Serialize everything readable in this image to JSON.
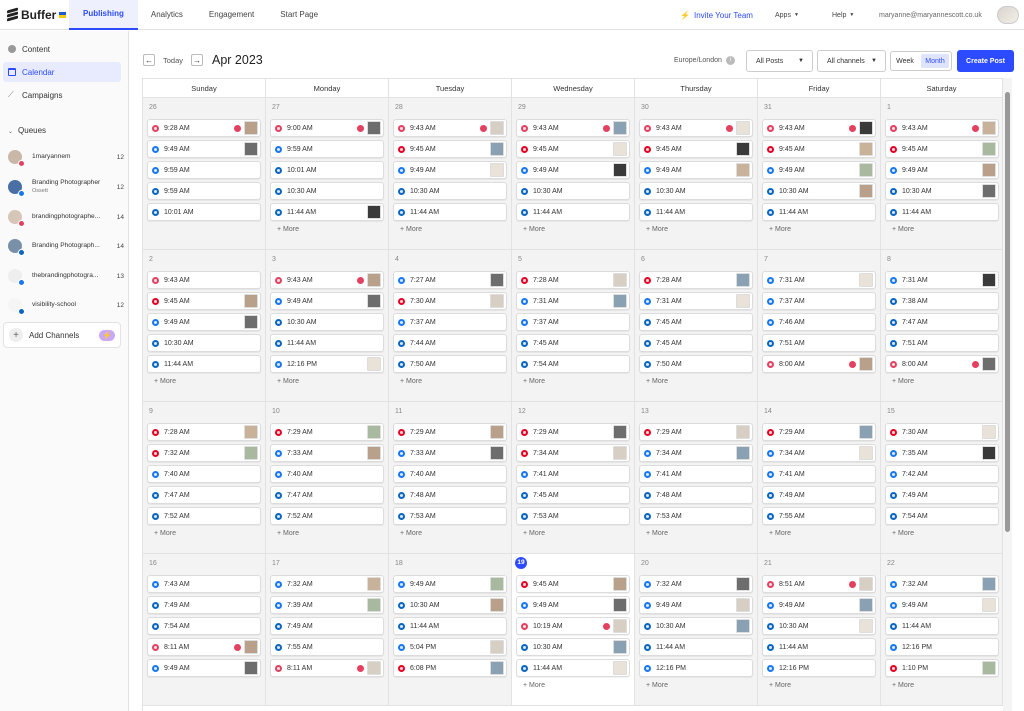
{
  "brand": {
    "name": "Buffer",
    "accent": "#2c4bff"
  },
  "topnav": {
    "tabs": [
      "Publishing",
      "Analytics",
      "Engagement",
      "Start Page"
    ],
    "active_tab": "Publishing",
    "invite": "Invite Your Team",
    "apps": "Apps",
    "help": "Help",
    "email": "maryanne@maryannescott.co.uk"
  },
  "sidebar": {
    "items": [
      {
        "label": "Content",
        "icon": "content-icon"
      },
      {
        "label": "Calendar",
        "icon": "calendar-icon",
        "active": true
      },
      {
        "label": "Campaigns",
        "icon": "campaigns-icon"
      }
    ],
    "queues_heading": "Queues",
    "queues": [
      {
        "name": "1maryannem",
        "sub": "",
        "count": "12",
        "network": "instagram"
      },
      {
        "name": "Branding Photographer",
        "sub": "Ossett",
        "count": "12",
        "network": "facebook"
      },
      {
        "name": "brandingphotographe...",
        "sub": "",
        "count": "14",
        "network": "instagram"
      },
      {
        "name": "Branding Photograph...",
        "sub": "",
        "count": "14",
        "network": "linkedin"
      },
      {
        "name": "thebrandingphotogra...",
        "sub": "",
        "count": "13",
        "network": "facebook"
      },
      {
        "name": "visibility-school",
        "sub": "",
        "count": "12",
        "network": "linkedin"
      }
    ],
    "add_channels": "Add Channels"
  },
  "toolbar": {
    "today": "Today",
    "month_title": "Apr 2023",
    "timezone": "Europe/London",
    "all_posts": "All Posts",
    "all_channels": "All channels",
    "week": "Week",
    "month": "Month",
    "create_post": "Create Post"
  },
  "calendar": {
    "weekdays": [
      "Sunday",
      "Monday",
      "Tuesday",
      "Wednesday",
      "Thursday",
      "Friday",
      "Saturday"
    ],
    "more_label": "+ More",
    "colors": {
      "instagram": "#e4405f",
      "facebook": "#1877f2",
      "linkedin": "#0a66c2",
      "pinterest": "#e60023",
      "twitter": "#1da1f2"
    },
    "weeks": [
      [
        {
          "day": "26",
          "posts": [
            [
              "9:28 AM",
              "instagram",
              1
            ],
            [
              "9:49 AM",
              "facebook",
              1
            ],
            [
              "9:59 AM",
              "facebook",
              0
            ],
            [
              "9:59 AM",
              "linkedin",
              0
            ],
            [
              "10:01 AM",
              "linkedin",
              0
            ]
          ],
          "more": false
        },
        {
          "day": "27",
          "posts": [
            [
              "9:00 AM",
              "instagram",
              1
            ],
            [
              "9:59 AM",
              "facebook",
              0
            ],
            [
              "10:01 AM",
              "linkedin",
              0
            ],
            [
              "10:30 AM",
              "linkedin",
              0
            ],
            [
              "11:44 AM",
              "linkedin",
              1
            ]
          ],
          "more": true
        },
        {
          "day": "28",
          "posts": [
            [
              "9:43 AM",
              "instagram",
              1
            ],
            [
              "9:45 AM",
              "pinterest",
              1
            ],
            [
              "9:49 AM",
              "facebook",
              1
            ],
            [
              "10:30 AM",
              "linkedin",
              0
            ],
            [
              "11:44 AM",
              "linkedin",
              0
            ]
          ],
          "more": true
        },
        {
          "day": "29",
          "posts": [
            [
              "9:43 AM",
              "instagram",
              1
            ],
            [
              "9:45 AM",
              "pinterest",
              1
            ],
            [
              "9:49 AM",
              "facebook",
              1
            ],
            [
              "10:30 AM",
              "linkedin",
              0
            ],
            [
              "11:44 AM",
              "linkedin",
              0
            ]
          ],
          "more": true
        },
        {
          "day": "30",
          "posts": [
            [
              "9:43 AM",
              "instagram",
              1
            ],
            [
              "9:45 AM",
              "pinterest",
              1
            ],
            [
              "9:49 AM",
              "facebook",
              1
            ],
            [
              "10:30 AM",
              "linkedin",
              0
            ],
            [
              "11:44 AM",
              "linkedin",
              0
            ]
          ],
          "more": true
        },
        {
          "day": "31",
          "posts": [
            [
              "9:43 AM",
              "instagram",
              1
            ],
            [
              "9:45 AM",
              "pinterest",
              1
            ],
            [
              "9:49 AM",
              "facebook",
              1
            ],
            [
              "10:30 AM",
              "linkedin",
              1
            ],
            [
              "11:44 AM",
              "linkedin",
              0
            ]
          ],
          "more": true
        },
        {
          "day": "1",
          "posts": [
            [
              "9:43 AM",
              "instagram",
              1
            ],
            [
              "9:45 AM",
              "pinterest",
              1
            ],
            [
              "9:49 AM",
              "facebook",
              1
            ],
            [
              "10:30 AM",
              "linkedin",
              1
            ],
            [
              "11:44 AM",
              "linkedin",
              0
            ]
          ],
          "more": true
        }
      ],
      [
        {
          "day": "2",
          "posts": [
            [
              "9:43 AM",
              "instagram",
              0
            ],
            [
              "9:45 AM",
              "pinterest",
              1
            ],
            [
              "9:49 AM",
              "facebook",
              1
            ],
            [
              "10:30 AM",
              "linkedin",
              0
            ],
            [
              "11:44 AM",
              "linkedin",
              0
            ]
          ],
          "more": true
        },
        {
          "day": "3",
          "posts": [
            [
              "9:43 AM",
              "instagram",
              1
            ],
            [
              "9:49 AM",
              "facebook",
              1
            ],
            [
              "10:30 AM",
              "linkedin",
              0
            ],
            [
              "11:44 AM",
              "linkedin",
              0
            ],
            [
              "12:16 PM",
              "facebook",
              1
            ]
          ],
          "more": true
        },
        {
          "day": "4",
          "posts": [
            [
              "7:27 AM",
              "facebook",
              1
            ],
            [
              "7:30 AM",
              "pinterest",
              1
            ],
            [
              "7:37 AM",
              "facebook",
              0
            ],
            [
              "7:44 AM",
              "linkedin",
              0
            ],
            [
              "7:50 AM",
              "linkedin",
              0
            ]
          ],
          "more": true
        },
        {
          "day": "5",
          "posts": [
            [
              "7:28 AM",
              "pinterest",
              1
            ],
            [
              "7:31 AM",
              "facebook",
              1
            ],
            [
              "7:37 AM",
              "facebook",
              0
            ],
            [
              "7:45 AM",
              "linkedin",
              0
            ],
            [
              "7:54 AM",
              "linkedin",
              0
            ]
          ],
          "more": true
        },
        {
          "day": "6",
          "posts": [
            [
              "7:28 AM",
              "pinterest",
              1
            ],
            [
              "7:31 AM",
              "facebook",
              1
            ],
            [
              "7:45 AM",
              "linkedin",
              0
            ],
            [
              "7:45 AM",
              "linkedin",
              0
            ],
            [
              "7:50 AM",
              "linkedin",
              0
            ]
          ],
          "more": true
        },
        {
          "day": "7",
          "posts": [
            [
              "7:31 AM",
              "facebook",
              1
            ],
            [
              "7:37 AM",
              "facebook",
              0
            ],
            [
              "7:46 AM",
              "facebook",
              0
            ],
            [
              "7:51 AM",
              "linkedin",
              0
            ],
            [
              "8:00 AM",
              "instagram",
              1
            ]
          ],
          "more": false
        },
        {
          "day": "8",
          "posts": [
            [
              "7:31 AM",
              "facebook",
              1
            ],
            [
              "7:38 AM",
              "linkedin",
              0
            ],
            [
              "7:47 AM",
              "linkedin",
              0
            ],
            [
              "7:51 AM",
              "linkedin",
              0
            ],
            [
              "8:00 AM",
              "instagram",
              1
            ]
          ],
          "more": true
        }
      ],
      [
        {
          "day": "9",
          "posts": [
            [
              "7:28 AM",
              "pinterest",
              1
            ],
            [
              "7:32 AM",
              "pinterest",
              1
            ],
            [
              "7:40 AM",
              "facebook",
              0
            ],
            [
              "7:47 AM",
              "linkedin",
              0
            ],
            [
              "7:52 AM",
              "linkedin",
              0
            ]
          ],
          "more": true
        },
        {
          "day": "10",
          "posts": [
            [
              "7:29 AM",
              "pinterest",
              1
            ],
            [
              "7:33 AM",
              "facebook",
              1
            ],
            [
              "7:40 AM",
              "facebook",
              0
            ],
            [
              "7:47 AM",
              "linkedin",
              0
            ],
            [
              "7:52 AM",
              "linkedin",
              0
            ]
          ],
          "more": true
        },
        {
          "day": "11",
          "posts": [
            [
              "7:29 AM",
              "pinterest",
              1
            ],
            [
              "7:33 AM",
              "facebook",
              1
            ],
            [
              "7:40 AM",
              "facebook",
              0
            ],
            [
              "7:48 AM",
              "linkedin",
              0
            ],
            [
              "7:53 AM",
              "linkedin",
              0
            ]
          ],
          "more": true
        },
        {
          "day": "12",
          "posts": [
            [
              "7:29 AM",
              "pinterest",
              1
            ],
            [
              "7:34 AM",
              "pinterest",
              1
            ],
            [
              "7:41 AM",
              "facebook",
              0
            ],
            [
              "7:45 AM",
              "linkedin",
              0
            ],
            [
              "7:53 AM",
              "linkedin",
              0
            ]
          ],
          "more": true
        },
        {
          "day": "13",
          "posts": [
            [
              "7:29 AM",
              "pinterest",
              1
            ],
            [
              "7:34 AM",
              "facebook",
              1
            ],
            [
              "7:41 AM",
              "facebook",
              0
            ],
            [
              "7:48 AM",
              "linkedin",
              0
            ],
            [
              "7:53 AM",
              "linkedin",
              0
            ]
          ],
          "more": true
        },
        {
          "day": "14",
          "posts": [
            [
              "7:29 AM",
              "pinterest",
              1
            ],
            [
              "7:34 AM",
              "facebook",
              1
            ],
            [
              "7:41 AM",
              "facebook",
              0
            ],
            [
              "7:49 AM",
              "linkedin",
              0
            ],
            [
              "7:55 AM",
              "linkedin",
              0
            ]
          ],
          "more": true
        },
        {
          "day": "15",
          "posts": [
            [
              "7:30 AM",
              "pinterest",
              1
            ],
            [
              "7:35 AM",
              "facebook",
              1
            ],
            [
              "7:42 AM",
              "facebook",
              0
            ],
            [
              "7:49 AM",
              "linkedin",
              0
            ],
            [
              "7:54 AM",
              "linkedin",
              0
            ]
          ],
          "more": true
        }
      ],
      [
        {
          "day": "16",
          "posts": [
            [
              "7:43 AM",
              "facebook",
              0
            ],
            [
              "7:49 AM",
              "linkedin",
              0
            ],
            [
              "7:54 AM",
              "linkedin",
              0
            ],
            [
              "8:11 AM",
              "instagram",
              1
            ],
            [
              "9:49 AM",
              "facebook",
              1
            ]
          ],
          "more": false
        },
        {
          "day": "17",
          "posts": [
            [
              "7:32 AM",
              "facebook",
              1
            ],
            [
              "7:39 AM",
              "facebook",
              1
            ],
            [
              "7:49 AM",
              "linkedin",
              0
            ],
            [
              "7:55 AM",
              "linkedin",
              0
            ],
            [
              "8:11 AM",
              "instagram",
              1
            ]
          ],
          "more": false
        },
        {
          "day": "18",
          "posts": [
            [
              "9:49 AM",
              "facebook",
              1
            ],
            [
              "10:30 AM",
              "linkedin",
              1
            ],
            [
              "11:44 AM",
              "linkedin",
              0
            ],
            [
              "5:04 PM",
              "facebook",
              1
            ],
            [
              "6:08 PM",
              "pinterest",
              1
            ]
          ],
          "more": false
        },
        {
          "day": "19",
          "today": true,
          "posts": [
            [
              "9:45 AM",
              "pinterest",
              1
            ],
            [
              "9:49 AM",
              "facebook",
              1
            ],
            [
              "10:19 AM",
              "instagram",
              1
            ],
            [
              "10:30 AM",
              "linkedin",
              1
            ],
            [
              "11:44 AM",
              "linkedin",
              1
            ]
          ],
          "more": true
        },
        {
          "day": "20",
          "posts": [
            [
              "7:32 AM",
              "facebook",
              1
            ],
            [
              "9:49 AM",
              "facebook",
              1
            ],
            [
              "10:30 AM",
              "linkedin",
              1
            ],
            [
              "11:44 AM",
              "linkedin",
              0
            ],
            [
              "12:16 PM",
              "facebook",
              0
            ]
          ],
          "more": true
        },
        {
          "day": "21",
          "posts": [
            [
              "8:51 AM",
              "instagram",
              1
            ],
            [
              "9:49 AM",
              "facebook",
              1
            ],
            [
              "10:30 AM",
              "linkedin",
              1
            ],
            [
              "11:44 AM",
              "linkedin",
              0
            ],
            [
              "12:16 PM",
              "facebook",
              0
            ]
          ],
          "more": true
        },
        {
          "day": "22",
          "posts": [
            [
              "7:32 AM",
              "facebook",
              1
            ],
            [
              "9:49 AM",
              "facebook",
              1
            ],
            [
              "11:44 AM",
              "linkedin",
              0
            ],
            [
              "12:16 PM",
              "facebook",
              0
            ],
            [
              "1:10 PM",
              "pinterest",
              1
            ]
          ],
          "more": true
        }
      ]
    ]
  }
}
